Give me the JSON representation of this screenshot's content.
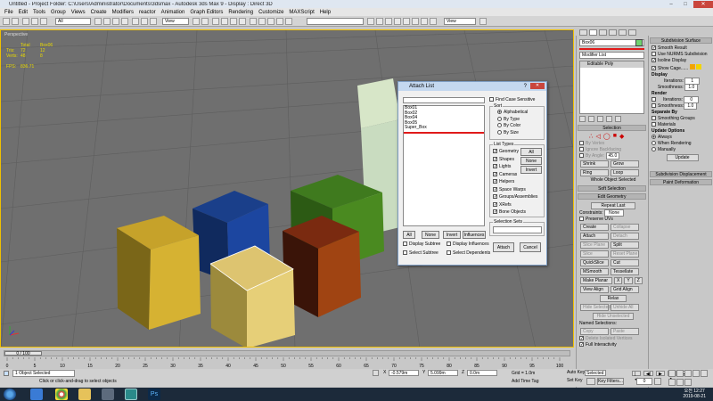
{
  "window": {
    "title": "Untitled    - Project Folder: C:\\Users\\Administrator\\Documents\\3dsmax     - Autodesk 3ds Max 9     - Display : Direct 3D"
  },
  "menu": [
    "File",
    "Edit",
    "Tools",
    "Group",
    "Views",
    "Create",
    "Modifiers",
    "reactor",
    "Animation",
    "Graph Editors",
    "Rendering",
    "Customize",
    "MAXScript",
    "Help"
  ],
  "toolbar": {
    "selection_filter": "All",
    "view_dropdown": "View",
    "view_dropdown2": "View"
  },
  "viewport": {
    "label": "Perspective",
    "stats": {
      "header_total": "Total",
      "header_obj": "Box06",
      "polys_label": "Tris:",
      "polys_total": "72",
      "polys_obj": "12",
      "verts_label": "Verts:",
      "verts_total": "48",
      "verts_obj": "8",
      "fps_label": "FPS:",
      "fps_value": "836.71"
    }
  },
  "command_panel": {
    "object_name": "Box06",
    "modifier_list": "Modifier List",
    "stack_item": "Editable Poly",
    "selection_title": "Selection",
    "by_vertex": "By Vertex",
    "ignore_backfacing": "Ignore Backfacing",
    "by_angle": "By Angle:",
    "by_angle_value": "45.0",
    "shrink": "Shrink",
    "grow": "Grow",
    "ring": "Ring",
    "loop": "Loop",
    "whole_selected": "Whole Object Selected",
    "soft_selection": "Soft Selection",
    "edit_geometry": "Edit Geometry",
    "repeat_last": "Repeat Last",
    "constraints": "Constraints:",
    "constraints_value": "None",
    "preserve_uvs": "Preserve UVs",
    "create": "Create",
    "collapse": "Collapse",
    "attach": "Attach",
    "detach": "Detach",
    "slice_plane": "Slice Plane",
    "split": "Split",
    "slice": "Slice",
    "reset_plane": "Reset Plane",
    "quickslice": "QuickSlice",
    "cut": "Cut",
    "msmooth": "MSmooth",
    "tessellate": "Tessellate",
    "make_planar": "Make Planar",
    "x": "X",
    "y": "Y",
    "z": "Z",
    "view_align": "View Align",
    "grid_align": "Grid Align",
    "relax": "Relax",
    "hide_selected": "Hide Selected",
    "unhide_all": "Unhide All",
    "hide_unselected": "Hide Unselected",
    "named_selections": "Named Selections:",
    "copy": "Copy",
    "paste": "Paste",
    "delete_isolated": "Delete Isolated Vertices",
    "full_interactivity": "Full Interactivity"
  },
  "right_panel": {
    "subdivision_surface": "Subdivision Surface",
    "smooth_result": "Smooth Result",
    "use_nurms": "Use NURMS Subdivision",
    "isoline_display": "Isoline Display",
    "show_cage": "Show Cage......",
    "display": "Display",
    "iterations_label": "Iterations:",
    "iterations_value": "1",
    "smoothness_label": "Smoothness:",
    "smoothness_value": "1.0",
    "render": "Render",
    "r_iterations_value": "0",
    "r_smoothness_value": "1.0",
    "separate_by": "Separate By",
    "smoothing_groups": "Smoothing Groups",
    "materials": "Materials",
    "update_options": "Update Options",
    "always": "Always",
    "when_rendering": "When Rendering",
    "manually": "Manually",
    "update": "Update",
    "subdivision_displacement": "Subdivision Displacement",
    "paint_deformation": "Paint Deformation"
  },
  "dialog": {
    "title": "Attach List",
    "objects": [
      "Box01",
      "Box02",
      "Box04",
      "Box05",
      "Super_Box"
    ],
    "find_case": "Find Case Sensitive",
    "sort_label": "Sort",
    "sort": [
      "Alphabetical",
      "By Type",
      "By Color",
      "By Size"
    ],
    "list_types_label": "List Types",
    "list_types": [
      "Geometry",
      "Shapes",
      "Lights",
      "Cameras",
      "Helpers",
      "Space Warps",
      "Groups/Assemblies",
      "XRefs",
      "Bone Objects"
    ],
    "all_btn": "All",
    "none_btn": "None",
    "invert_btn": "Invert",
    "bottom_all": "All",
    "bottom_none": "None",
    "bottom_invert": "Invert",
    "influences": "Influences",
    "display_subtree": "Display Subtree",
    "display_influences": "Display Influences",
    "select_subtree": "Select Subtree",
    "select_dependents": "Select Dependents",
    "selection_sets": "Selection Sets",
    "attach": "Attach",
    "cancel": "Cancel"
  },
  "timeline": {
    "frame": "0 / 100",
    "ticks": [
      "0",
      "5",
      "10",
      "15",
      "20",
      "25",
      "30",
      "35",
      "40",
      "45",
      "50",
      "55",
      "60",
      "65",
      "70",
      "75",
      "80",
      "85",
      "90",
      "95",
      "100"
    ]
  },
  "status": {
    "selected": "1 Object Selected",
    "prompt": "Click or click-and-drag to select objects",
    "x": "-0.579m",
    "y": "5.099m",
    "z": "0.0m",
    "grid": "Grid = 1.0m",
    "add_time_tag": "Add Time Tag",
    "auto_key": "Auto Key",
    "set_key": "Set Key",
    "selected_dd": "Selected",
    "key_filters": "Key Filters...",
    "frame_value": "0"
  },
  "taskbar": {
    "time": "오전 12:27",
    "date": "2019-08-21"
  }
}
